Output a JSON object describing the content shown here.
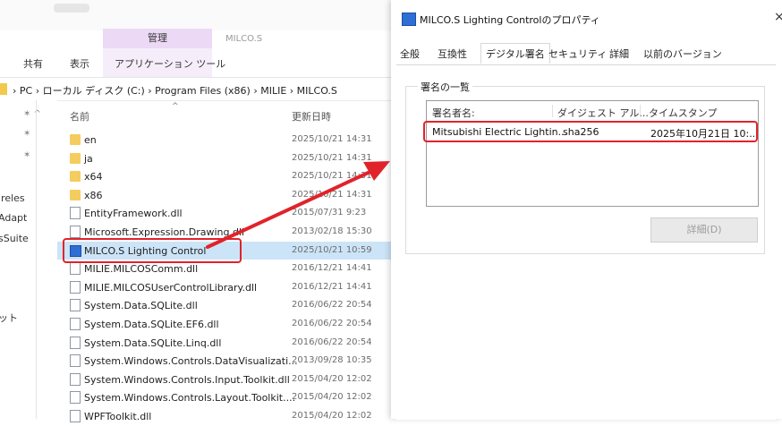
{
  "explorer": {
    "manage_tab": "管理",
    "context_tab": "MILCO.S",
    "ribbon": {
      "share": "共有",
      "view": "表示",
      "app_tools": "アプリケーション ツール"
    },
    "address_path": "› PC › ローカル ディスク (C:) › Program Files (x86) › MILIE › MILCO.S",
    "nav_items": [
      "ireles",
      "Adapt",
      "sSuite",
      "ット"
    ],
    "col_name": "名前",
    "col_date": "更新日時",
    "files": [
      {
        "name": "en",
        "date": "2025/10/21 14:31",
        "icon": "folder-icon"
      },
      {
        "name": "ja",
        "date": "2025/10/21 14:31",
        "icon": "folder-icon"
      },
      {
        "name": "x64",
        "date": "2025/10/21 14:31",
        "icon": "folder-icon"
      },
      {
        "name": "x86",
        "date": "2025/10/21 14:31",
        "icon": "folder-icon"
      },
      {
        "name": "EntityFramework.dll",
        "date": "2015/07/31 9:23",
        "icon": "dll-file-icon"
      },
      {
        "name": "Microsoft.Expression.Drawing.dll",
        "date": "2013/02/18 15:30",
        "icon": "dll-file-icon"
      },
      {
        "name": "MILCO.S Lighting Control",
        "date": "2025/10/21 10:59",
        "icon": "app-icon"
      },
      {
        "name": "MILIE.MILCOSComm.dll",
        "date": "2016/12/21 14:41",
        "icon": "dll-file-icon"
      },
      {
        "name": "MILIE.MILCOSUserControlLibrary.dll",
        "date": "2016/12/21 14:41",
        "icon": "dll-file-icon"
      },
      {
        "name": "System.Data.SQLite.dll",
        "date": "2016/06/22 20:54",
        "icon": "dll-file-icon"
      },
      {
        "name": "System.Data.SQLite.EF6.dll",
        "date": "2016/06/22 20:54",
        "icon": "dll-file-icon"
      },
      {
        "name": "System.Data.SQLite.Linq.dll",
        "date": "2016/06/22 20:54",
        "icon": "dll-file-icon"
      },
      {
        "name": "System.Windows.Controls.DataVisualizati...",
        "date": "2013/09/28 10:35",
        "icon": "dll-file-icon"
      },
      {
        "name": "System.Windows.Controls.Input.Toolkit.dll",
        "date": "2015/04/20 12:02",
        "icon": "dll-file-icon"
      },
      {
        "name": "System.Windows.Controls.Layout.Toolkit....",
        "date": "2015/04/20 12:02",
        "icon": "dll-file-icon"
      },
      {
        "name": "WPFToolkit.dll",
        "date": "2015/04/20 12:02",
        "icon": "dll-file-icon"
      }
    ]
  },
  "dialog": {
    "title": "MILCO.S Lighting Controlのプロパティ",
    "close": "×",
    "tabs": [
      "全般",
      "互換性",
      "デジタル署名",
      "セキュリティ",
      "詳細",
      "以前のバージョン"
    ],
    "active_tab": "デジタル署名",
    "group_label": "署名の一覧",
    "columns": [
      "署名者名:",
      "ダイジェスト アル...",
      "タイムスタンプ"
    ],
    "signature": {
      "signer": "Mitsubishi Electric Lightin...",
      "digest": "sha256",
      "timestamp": "2025年10月21日 10:..."
    },
    "details_button": "詳細(D)"
  },
  "colors": {
    "highlight": "#e0232b",
    "manage_tab": "#ecd9f5",
    "accent": "#2e6fd6"
  }
}
